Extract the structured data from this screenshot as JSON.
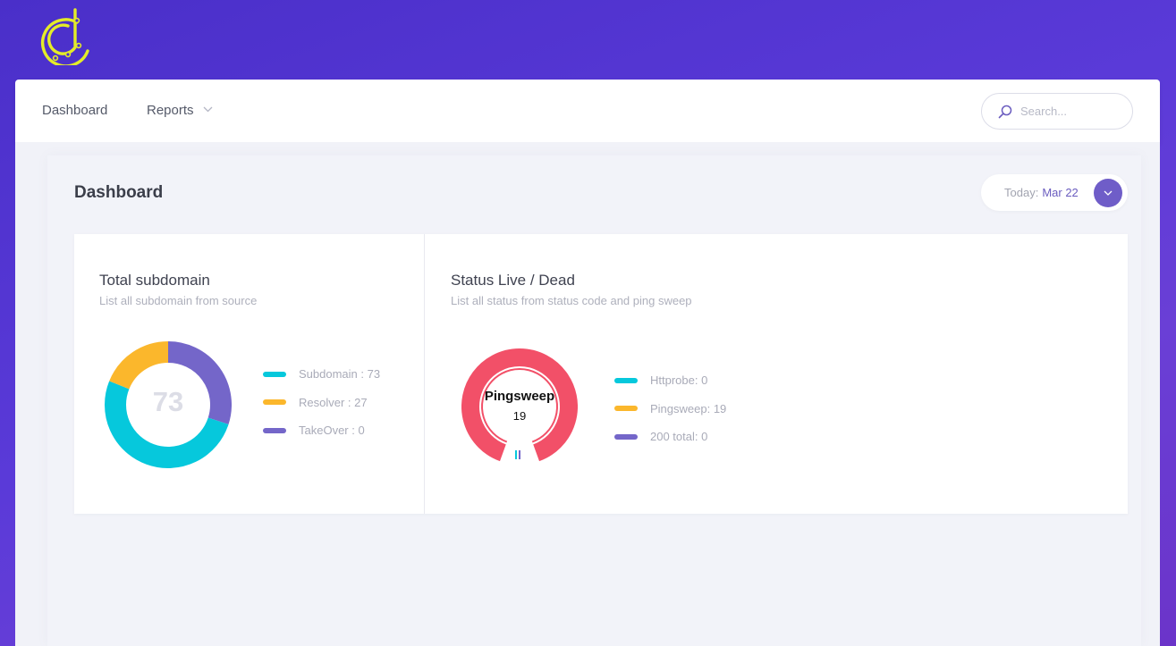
{
  "nav": {
    "items": [
      {
        "label": "Dashboard"
      },
      {
        "label": "Reports"
      }
    ]
  },
  "search": {
    "placeholder": "Search..."
  },
  "page": {
    "title": "Dashboard"
  },
  "date": {
    "label": "Today:",
    "value": "Mar 22"
  },
  "colors": {
    "cyan": "#06c8dc",
    "yellow": "#fbb72c",
    "purple": "#7466c9",
    "red": "#f25068"
  },
  "card_subdomain": {
    "title": "Total subdomain",
    "subtitle": "List all subdomain from source",
    "total": "73",
    "legend": [
      {
        "label": "Subdomain : 73",
        "color": "#06c8dc"
      },
      {
        "label": "Resolver : 27",
        "color": "#fbb72c"
      },
      {
        "label": "TakeOver : 0",
        "color": "#7466c9"
      }
    ]
  },
  "card_status": {
    "title": "Status Live / Dead",
    "subtitle": "List all status from status code and ping sweep",
    "center_title": "Pingsweep",
    "center_value": "19",
    "legend": [
      {
        "label": "Httprobe: 0",
        "color": "#06c8dc"
      },
      {
        "label": "Pingsweep: 19",
        "color": "#fbb72c"
      },
      {
        "label": "200 total: 0",
        "color": "#7466c9"
      }
    ]
  },
  "chart_data": [
    {
      "type": "pie",
      "title": "Total subdomain",
      "categories": [
        "Subdomain",
        "Resolver",
        "TakeOver"
      ],
      "values": [
        73,
        27,
        0
      ]
    },
    {
      "type": "pie",
      "title": "Status Live / Dead",
      "categories": [
        "Httprobe",
        "Pingsweep",
        "200 total"
      ],
      "values": [
        0,
        19,
        0
      ]
    }
  ]
}
